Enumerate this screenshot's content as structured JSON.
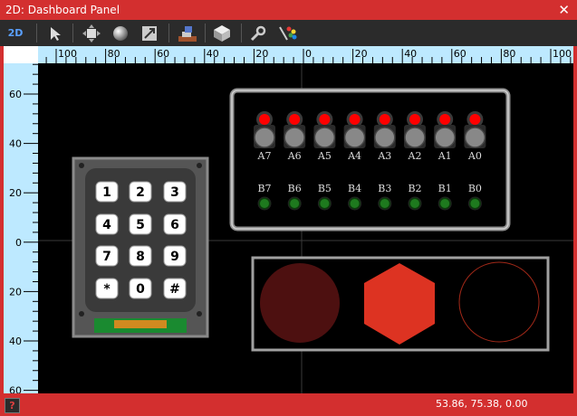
{
  "window": {
    "title": "2D: Dashboard Panel"
  },
  "toolbar": {
    "mode_label": "2D",
    "tools": [
      "select-arrow-icon",
      "move-icon",
      "sphere-icon",
      "scale-icon",
      "layers-icon",
      "cube-icon",
      "wrench-icon",
      "color-brush-icon"
    ]
  },
  "rulers": {
    "horizontal": [
      "100",
      "80",
      "60",
      "40",
      "20",
      "0",
      "20",
      "40",
      "60",
      "80",
      "100"
    ],
    "vertical": [
      "60",
      "40",
      "20",
      "0",
      "20",
      "40",
      "60"
    ]
  },
  "led_panel": {
    "a_labels": [
      "A7",
      "A6",
      "A5",
      "A4",
      "A3",
      "A2",
      "A1",
      "A0"
    ],
    "b_labels": [
      "B7",
      "B6",
      "B5",
      "B4",
      "B3",
      "B2",
      "B1",
      "B0"
    ]
  },
  "keypad": {
    "keys": [
      "1",
      "2",
      "3",
      "4",
      "5",
      "6",
      "7",
      "8",
      "9",
      "*",
      "0",
      "#"
    ]
  },
  "colors": {
    "led_red": "#ff0000",
    "led_green": "#1e7a1e",
    "shape_dark_red": "#4d1010",
    "shape_red": "#dd3322",
    "frame_red": "#d32f2f"
  },
  "statusbar": {
    "coordinates": "53.86, 75.38, 0.00",
    "help_label": "?"
  }
}
